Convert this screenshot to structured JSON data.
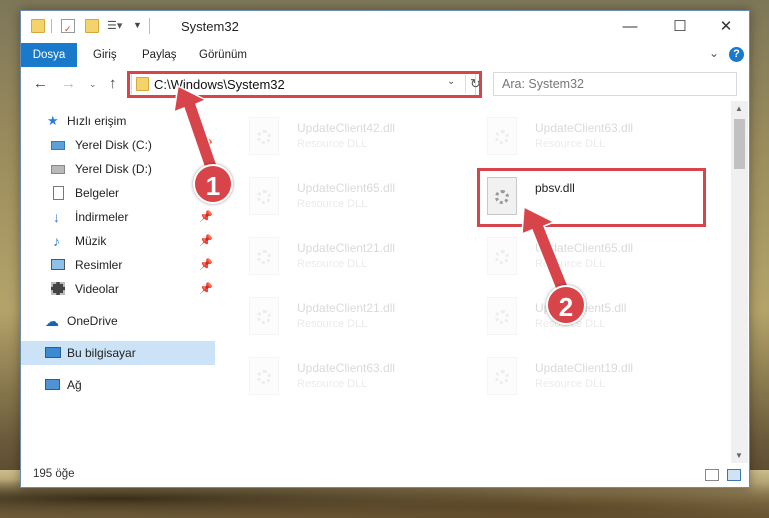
{
  "window": {
    "title": "System32"
  },
  "ribbon": {
    "tabs": [
      "Dosya",
      "Giriş",
      "Paylaş",
      "Görünüm"
    ],
    "help": "?"
  },
  "address": {
    "path": "C:\\Windows\\System32",
    "search_placeholder": "Ara: System32"
  },
  "sidebar": {
    "items": [
      {
        "label": "Hızlı erişim",
        "icon": "star-icon"
      },
      {
        "label": "Yerel Disk (C:)",
        "icon": "drive-icon",
        "pinned": true
      },
      {
        "label": "Yerel Disk (D:)",
        "icon": "drive-icon"
      },
      {
        "label": "Belgeler",
        "icon": "documents-icon"
      },
      {
        "label": "İndirmeler",
        "icon": "download-icon",
        "pinned": true
      },
      {
        "label": "Müzik",
        "icon": "music-icon",
        "pinned": true
      },
      {
        "label": "Resimler",
        "icon": "pictures-icon",
        "pinned": true
      },
      {
        "label": "Videolar",
        "icon": "videos-icon",
        "pinned": true
      },
      {
        "label": "OneDrive",
        "icon": "cloud-icon"
      },
      {
        "label": "Bu bilgisayar",
        "icon": "computer-icon",
        "selected": true
      },
      {
        "label": "Ağ",
        "icon": "network-icon"
      }
    ]
  },
  "files": [
    {
      "name": "UpdateClient42.dll",
      "type": "Resource DLL"
    },
    {
      "name": "UpdateClient63.dll",
      "type": "Resource DLL"
    },
    {
      "name": "UpdateClient65.dll",
      "type": "Resource DLL"
    },
    {
      "name": "pbsv.dll",
      "type": ""
    },
    {
      "name": "UpdateClient21.dll",
      "type": "Resource DLL"
    },
    {
      "name": "UpdateClient65.dll",
      "type": "Resource DLL"
    },
    {
      "name": "UpdateClient21.dll",
      "type": "Resource DLL"
    },
    {
      "name": "UpdateClient5.dll",
      "type": "Resource DLL"
    },
    {
      "name": "UpdateClient63.dll",
      "type": "Resource DLL"
    },
    {
      "name": "UpdateClient19.dll",
      "type": "Resource DLL"
    }
  ],
  "status": {
    "item_count": "195 öğe"
  },
  "annotations": {
    "step1": "1",
    "step2": "2",
    "color": "#d7444a"
  }
}
